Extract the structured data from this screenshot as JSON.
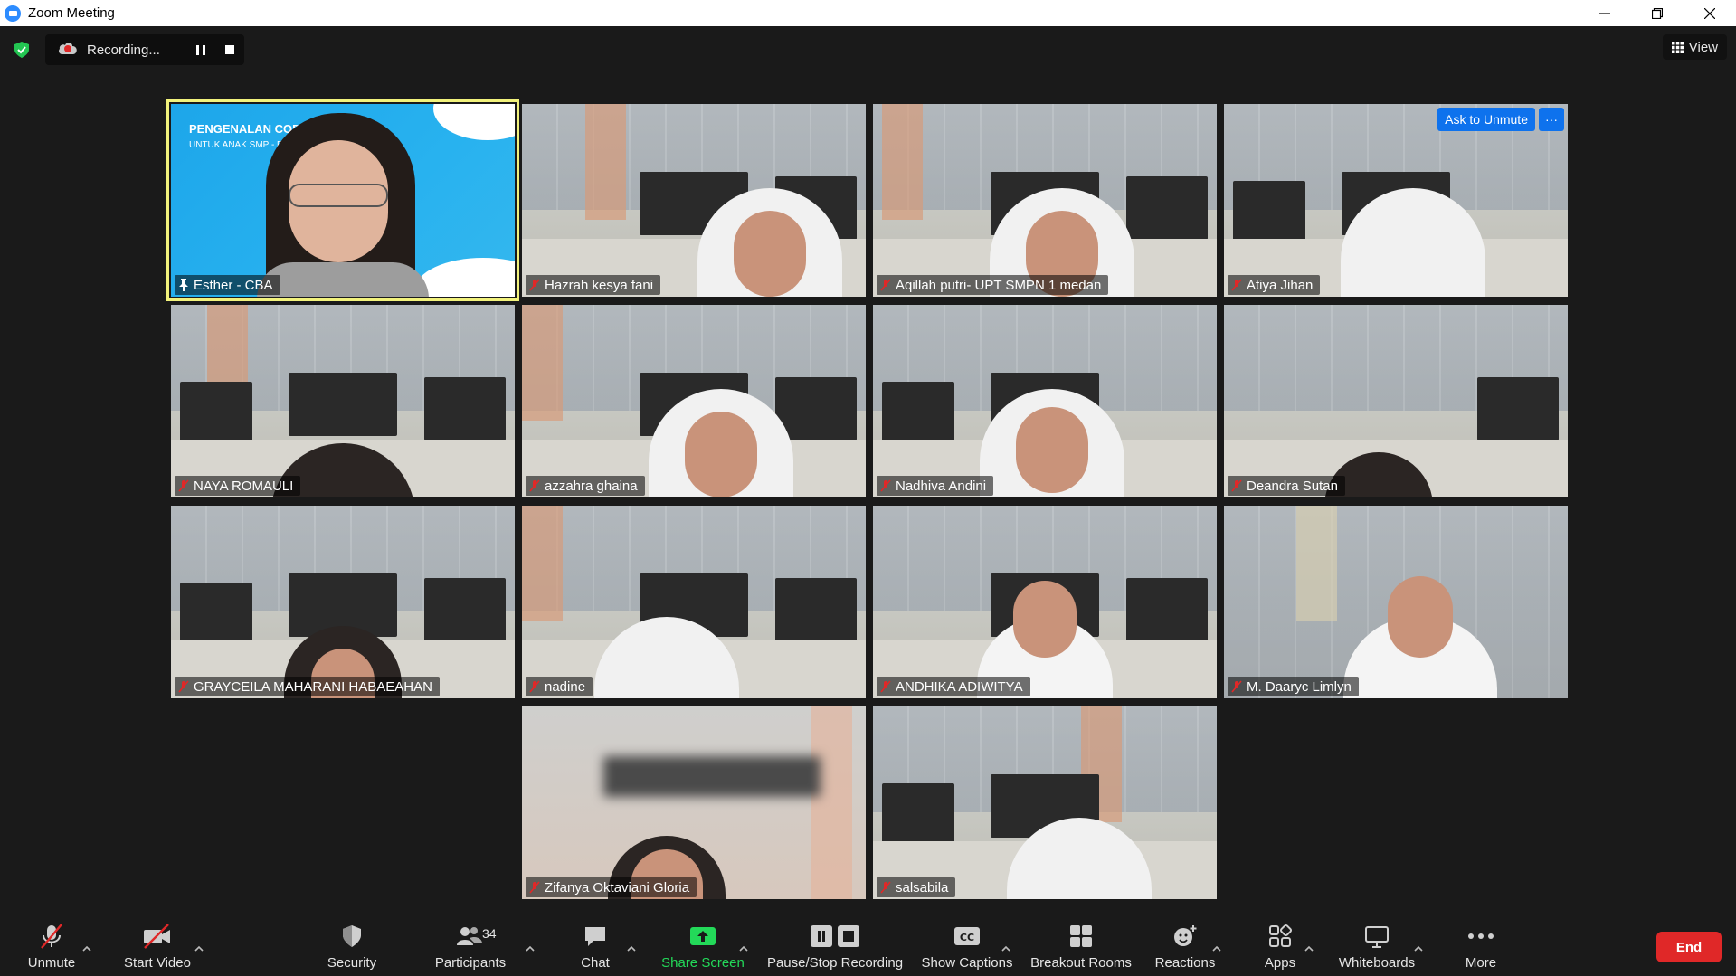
{
  "window": {
    "title": "Zoom Meeting"
  },
  "recording": {
    "status": "Recording..."
  },
  "view": {
    "label": "View"
  },
  "pinned_slide": {
    "title": "PENGENALAN COD",
    "subtitle": "UNTUK ANAK SMP - P"
  },
  "tiles": [
    {
      "name": "Esther - CBA",
      "pinned": true
    },
    {
      "name": "Hazrah kesya fani",
      "muted": true
    },
    {
      "name": "Aqillah putri- UPT SMPN 1 medan",
      "muted": true
    },
    {
      "name": "Atiya Jihan",
      "muted": true
    },
    {
      "name": "NAYA ROMAULI",
      "muted": true
    },
    {
      "name": "azzahra ghaina",
      "muted": true
    },
    {
      "name": "Nadhiva Andini",
      "muted": true
    },
    {
      "name": "Deandra Sutan",
      "muted": true
    },
    {
      "name": "GRAYCEILA MAHARANI HABAEAHAN",
      "muted": true
    },
    {
      "name": "nadine",
      "muted": true
    },
    {
      "name": "ANDHIKA ADIWITYA",
      "muted": true
    },
    {
      "name": "M. Daaryc Limlyn",
      "muted": true
    },
    {
      "name": "Zifanya Oktaviani Gloria",
      "muted": true
    },
    {
      "name": "salsabila",
      "muted": true
    }
  ],
  "tile_actions": {
    "ask_to_unmute": "Ask to Unmute",
    "more": "···"
  },
  "toolbar": {
    "unmute": "Unmute",
    "start_video": "Start Video",
    "security": "Security",
    "participants": "Participants",
    "participants_count": "34",
    "chat": "Chat",
    "share_screen": "Share Screen",
    "pause_stop_recording": "Pause/Stop Recording",
    "show_captions": "Show Captions",
    "breakout_rooms": "Breakout Rooms",
    "reactions": "Reactions",
    "apps": "Apps",
    "whiteboards": "Whiteboards",
    "more": "More",
    "end": "End"
  },
  "colors": {
    "accent_blue": "#0e72ed",
    "end_red": "#e02828",
    "share_green": "#23d959",
    "pinned_outline": "#f2f27c",
    "muted_red": "#e02828"
  }
}
